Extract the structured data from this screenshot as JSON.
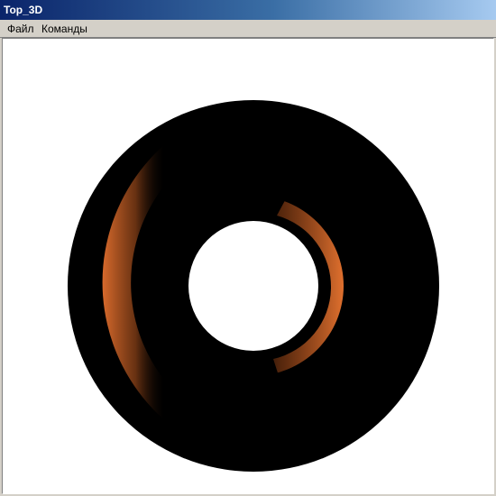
{
  "window": {
    "title": "Top_3D"
  },
  "menu": {
    "items": [
      "Файл",
      "Команды"
    ]
  },
  "scene": {
    "background": "#ffffff",
    "torus_color": "#000000",
    "highlight_color": "#d86a2c"
  }
}
